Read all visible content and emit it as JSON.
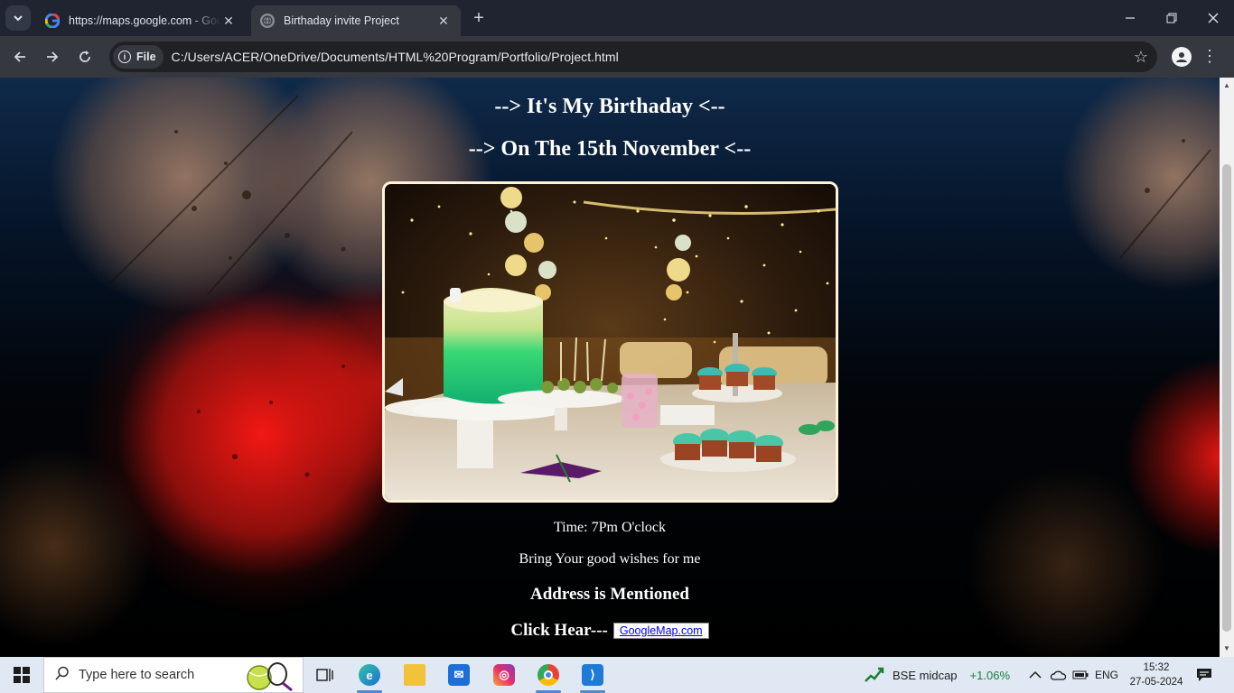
{
  "browser": {
    "tabs": [
      {
        "title": "https://maps.google.com - Goo",
        "active": false
      },
      {
        "title": "Birthaday invite Project",
        "active": true
      }
    ],
    "chip_label": "File",
    "url": "C:/Users/ACER/OneDrive/Documents/HTML%20Program/Portfolio/Project.html"
  },
  "page": {
    "heading1": "--> It's My Birthaday <--",
    "heading2": "--> On The 15th November <--",
    "time": "Time: 7Pm O'clock",
    "wishes": "Bring Your good wishes for me",
    "address": "Address is Mentioned",
    "click_text": "Click Hear---",
    "map_link": "GoogleMap.com"
  },
  "taskbar": {
    "search_placeholder": "Type here to search",
    "stock_name": "BSE midcap",
    "stock_change": "+1.06%",
    "language": "ENG",
    "time": "15:32",
    "date": "27-05-2024"
  },
  "colors": {
    "tabbar": "#1f2430",
    "toolbar": "#35393f",
    "photo_border": "#fff3da",
    "stock_change": "#1a7f37"
  }
}
